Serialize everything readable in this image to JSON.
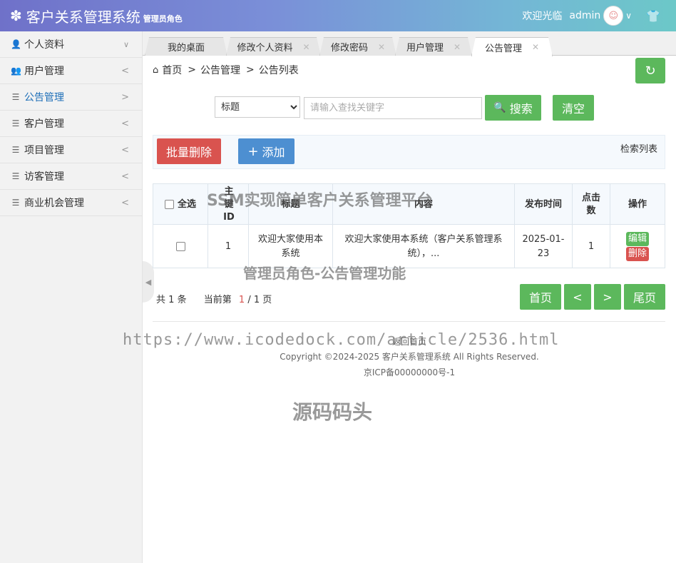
{
  "header": {
    "title": "客户关系管理系统",
    "role_tag": "管理员角色",
    "welcome": "欢迎光临",
    "username": "admin"
  },
  "sidebar": {
    "items": [
      {
        "label": "个人资料",
        "icon": "user-icon",
        "arrow": "∨"
      },
      {
        "label": "用户管理",
        "icon": "users-icon",
        "arrow": "<"
      },
      {
        "label": "公告管理",
        "icon": "menu-icon",
        "arrow": ">",
        "active": true
      },
      {
        "label": "客户管理",
        "icon": "menu-icon",
        "arrow": "<"
      },
      {
        "label": "项目管理",
        "icon": "menu-icon",
        "arrow": "<"
      },
      {
        "label": "访客管理",
        "icon": "menu-icon",
        "arrow": "<"
      },
      {
        "label": "商业机会管理",
        "icon": "menu-icon",
        "arrow": "<"
      }
    ]
  },
  "tabs": [
    {
      "label": "我的桌面",
      "closable": false
    },
    {
      "label": "修改个人资料",
      "closable": true
    },
    {
      "label": "修改密码",
      "closable": true
    },
    {
      "label": "用户管理",
      "closable": true
    },
    {
      "label": "公告管理",
      "closable": true,
      "active": true
    }
  ],
  "breadcrumb": [
    "首页",
    "公告管理",
    "公告列表"
  ],
  "search": {
    "field_selected": "标题",
    "placeholder": "请输入查找关键字",
    "search_label": "搜索",
    "clear_label": "清空"
  },
  "toolbar": {
    "batch_delete_label": "批量删除",
    "add_label": "添加",
    "search_list_label": "检索列表"
  },
  "table": {
    "headers": [
      "全选",
      "主键ID",
      "标题",
      "内容",
      "发布时间",
      "点击数",
      "操作"
    ],
    "rows": [
      {
        "id": "1",
        "title": "欢迎大家使用本系统",
        "content": "欢迎大家使用本系统（客户关系管理系统），...",
        "publish_time": "2025-01-23",
        "clicks": "1",
        "edit_label": "编辑",
        "delete_label": "删除"
      }
    ]
  },
  "pagination": {
    "total_prefix": "共",
    "total": "1",
    "total_suffix": "条",
    "current_prefix": "当前第",
    "current": "1",
    "pages": "/ 1 页",
    "first_label": "首页",
    "prev_label": "<",
    "next_label": ">",
    "last_label": "尾页"
  },
  "footer": {
    "home_link": "返回首页",
    "copyright": "Copyright ©2024-2025 客户关系管理系统 All Rights Reserved.",
    "icp": "京ICP备00000000号-1"
  },
  "watermarks": {
    "title": "SSM实现简单客户关系管理平台",
    "subtitle": "管理员角色-公告管理功能",
    "url": "https://www.icodedock.com/article/2536.html",
    "brand": "源码码头"
  },
  "colors": {
    "primary_green": "#5cb85c",
    "danger_red": "#d9534f",
    "add_blue": "#4d8fd1",
    "active_link": "#1e6fb8"
  }
}
